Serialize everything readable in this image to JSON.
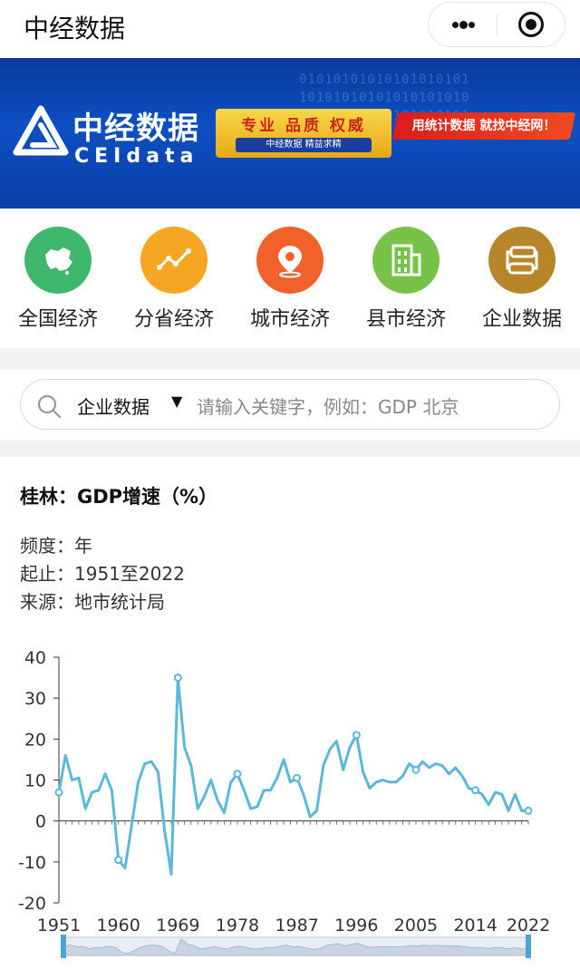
{
  "app": {
    "title": "中经数据"
  },
  "banner": {
    "brand_cn": "中经数据",
    "brand_en": "CEIdata",
    "slogan": "专业 品质 权威",
    "slogan_sub": "中经数据 精益求精",
    "tagline": "用统计数据 就找中经网！",
    "binary_text": "01010101010101010101\n10101010101010101010\n01010101010101010101\n10101010101010101010"
  },
  "categories": [
    {
      "label": "全国经济",
      "icon": "china-map-icon",
      "color": "#3fb86d"
    },
    {
      "label": "分省经济",
      "icon": "trend-line-icon",
      "color": "#f5a623"
    },
    {
      "label": "城市经济",
      "icon": "location-pin-icon",
      "color": "#f2612c"
    },
    {
      "label": "县市经济",
      "icon": "building-icon",
      "color": "#79c24a"
    },
    {
      "label": "企业数据",
      "icon": "factory-flow-icon",
      "color": "#b7862b"
    }
  ],
  "search": {
    "scope": "企业数据",
    "placeholder": "请输入关键字，例如：GDP 北京"
  },
  "info": {
    "title": "桂林：GDP增速（%）",
    "frequency": "频度：年",
    "range": "起止：1951至2022",
    "source": "来源：地市统计局"
  },
  "chart_data": {
    "type": "line",
    "title": "桂林：GDP增速（%）",
    "xlabel": "",
    "ylabel": "",
    "ylim": [
      -20,
      40
    ],
    "yticks": [
      -20,
      -10,
      0,
      10,
      20,
      30,
      40
    ],
    "xtick_labels": [
      "1951",
      "1960",
      "1969",
      "1978",
      "1987",
      "1996",
      "2005",
      "2014",
      "2022"
    ],
    "line_color": "#5bb8d8",
    "grid": false,
    "legend": "none",
    "x": [
      1951,
      1952,
      1953,
      1954,
      1955,
      1956,
      1957,
      1958,
      1959,
      1960,
      1961,
      1962,
      1963,
      1964,
      1965,
      1966,
      1967,
      1968,
      1969,
      1970,
      1971,
      1972,
      1973,
      1974,
      1975,
      1976,
      1977,
      1978,
      1979,
      1980,
      1981,
      1982,
      1983,
      1984,
      1985,
      1986,
      1987,
      1988,
      1989,
      1990,
      1991,
      1992,
      1993,
      1994,
      1995,
      1996,
      1997,
      1998,
      1999,
      2000,
      2001,
      2002,
      2003,
      2004,
      2005,
      2006,
      2007,
      2008,
      2009,
      2010,
      2011,
      2012,
      2013,
      2014,
      2015,
      2016,
      2017,
      2018,
      2019,
      2020,
      2021,
      2022
    ],
    "values": [
      7.0,
      16.0,
      10.0,
      10.5,
      3.0,
      7.0,
      7.5,
      11.5,
      7.5,
      -9.5,
      -11.5,
      -1.0,
      9.5,
      14.0,
      14.5,
      12.0,
      -2.5,
      -13.0,
      35.0,
      18.0,
      13.5,
      3.0,
      6.0,
      10.0,
      5.0,
      2.0,
      9.5,
      11.5,
      7.5,
      3.0,
      3.5,
      7.5,
      7.5,
      10.5,
      15.0,
      9.5,
      10.5,
      6.5,
      1.0,
      2.5,
      13.5,
      17.5,
      19.5,
      12.5,
      18.0,
      21.0,
      12.0,
      8.0,
      9.5,
      10.0,
      9.5,
      9.5,
      11.0,
      14.0,
      12.5,
      14.5,
      13.0,
      14.0,
      13.5,
      11.5,
      13.0,
      11.0,
      8.0,
      7.5,
      6.5,
      4.0,
      7.0,
      6.5,
      2.5,
      6.5,
      2.5,
      2.5
    ],
    "markers": [
      1951,
      1960,
      1969,
      1978,
      1987,
      1996,
      2005,
      2014,
      2022
    ]
  }
}
